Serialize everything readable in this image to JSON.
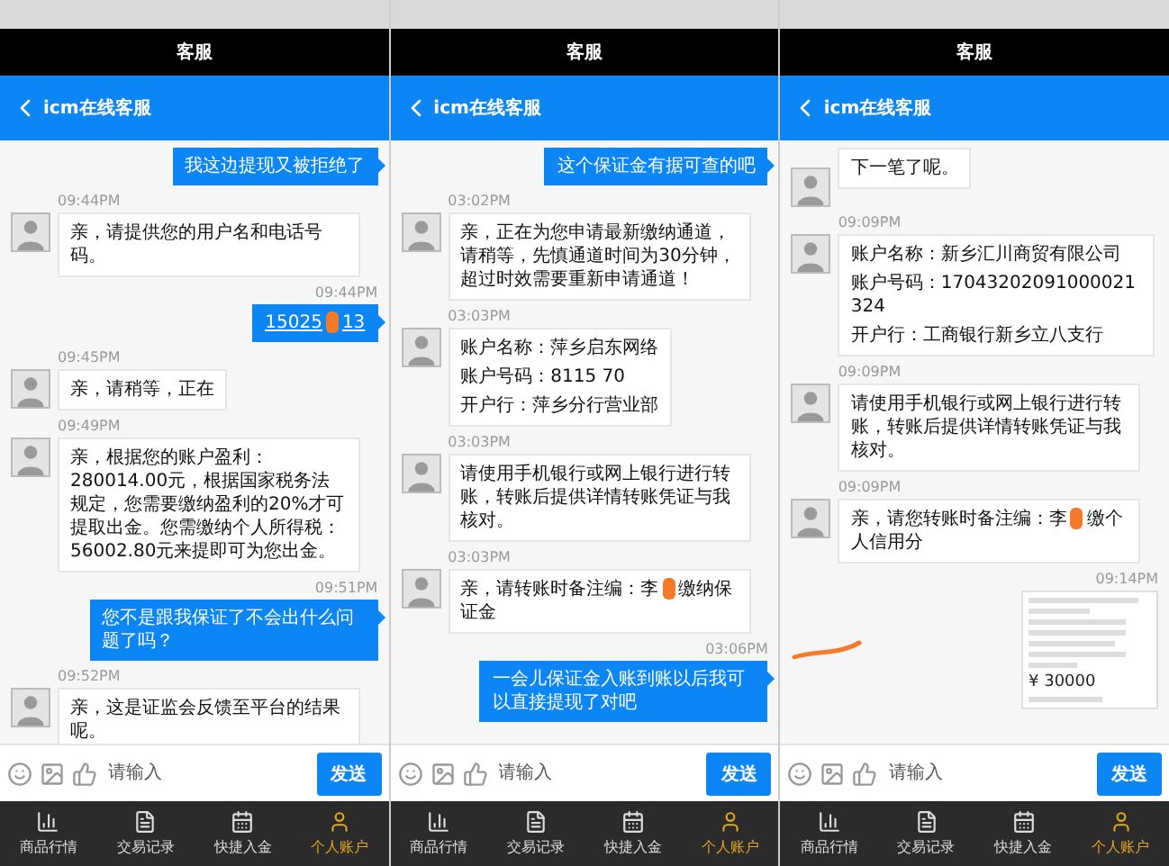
{
  "panels": [
    {
      "header_title": "客服",
      "nav_title": "icm在线客服",
      "messages": [
        {
          "kind": "sent",
          "segments": [
            "我这边提现又被拒绝了"
          ]
        },
        {
          "kind": "received",
          "time": "09:44PM",
          "segments": [
            "亲，请提供您的用户名和电话号码。"
          ]
        },
        {
          "kind": "sent",
          "time": "09:44PM",
          "link": true,
          "segments": [
            "15025",
            "13"
          ]
        },
        {
          "kind": "received",
          "time": "09:45PM",
          "segments": [
            "亲，请稍等，正在"
          ]
        },
        {
          "kind": "received",
          "time": "09:49PM",
          "segments": [
            "亲，根据您的账户盈利：280014.00元，根据国家税务法规定，您需要缴纳盈利的20%才可提取出金。您需缴纳个人所得税：56002.80元来提即可为您出金。"
          ]
        },
        {
          "kind": "sent",
          "time": "09:51PM",
          "segments": [
            "您不是跟我保证了不会出什么问题了吗？"
          ]
        },
        {
          "kind": "received",
          "time": "09:52PM",
          "segments": [
            "亲，这是证监会反馈至平台的结果呢。"
          ]
        }
      ],
      "input_placeholder": "请输入",
      "send_label": "发送",
      "tabs": [
        {
          "label": "商品行情",
          "selected": false
        },
        {
          "label": "交易记录",
          "selected": false
        },
        {
          "label": "快捷入金",
          "selected": false
        },
        {
          "label": "个人账户",
          "selected": true
        }
      ]
    },
    {
      "header_title": "客服",
      "nav_title": "icm在线客服",
      "messages": [
        {
          "kind": "sent",
          "segments": [
            "这个保证金有据可查的吧"
          ]
        },
        {
          "kind": "received",
          "time": "03:02PM",
          "segments": [
            "亲，正在为您申请最新缴纳通道，请稍等，先慎通道时间为30分钟，超过时效需要重新申请通道！"
          ]
        },
        {
          "kind": "account",
          "time": "03:03PM",
          "lines": [
            "账户名称：萍乡启东网络",
            "账户号码：8115 70",
            "开户行：萍乡分行营业部"
          ]
        },
        {
          "kind": "received",
          "time": "03:03PM",
          "segments": [
            "请使用手机银行或网上银行进行转账，转账后提供详情转账凭证与我核对。"
          ]
        },
        {
          "kind": "received",
          "time": "03:03PM",
          "segments": [
            "亲，请转账时备注编：李",
            "缴纳保证金"
          ]
        },
        {
          "kind": "sent",
          "time": "03:06PM",
          "segments": [
            "一会儿保证金入账到账以后我可以直接提现了对吧"
          ]
        }
      ],
      "input_placeholder": "请输入",
      "send_label": "发送",
      "tabs": [
        {
          "label": "商品行情",
          "selected": false
        },
        {
          "label": "交易记录",
          "selected": false
        },
        {
          "label": "快捷入金",
          "selected": false
        },
        {
          "label": "个人账户",
          "selected": true
        }
      ]
    },
    {
      "header_title": "客服",
      "nav_title": "icm在线客服",
      "messages": [
        {
          "kind": "received",
          "segments": [
            "下一笔了呢。"
          ]
        },
        {
          "kind": "account",
          "time": "09:09PM",
          "lines": [
            "账户名称：新乡汇川商贸有限公司",
            "账户号码：17043202091000021324",
            "开户行：工商银行新乡立八支行"
          ]
        },
        {
          "kind": "received",
          "time": "09:09PM",
          "segments": [
            "请使用手机银行或网上银行进行转账，转账后提供详情转账凭证与我核对。"
          ]
        },
        {
          "kind": "received",
          "time": "09:09PM",
          "segments": [
            "亲，请您转账时备注编：李",
            "缴个人信用分"
          ]
        },
        {
          "kind": "image",
          "time": "09:14PM",
          "amount": "¥ 30000"
        }
      ],
      "input_placeholder": "请输入",
      "send_label": "发送",
      "tabs": [
        {
          "label": "商品行情",
          "selected": false
        },
        {
          "label": "交易记录",
          "selected": false
        },
        {
          "label": "快捷入金",
          "selected": false
        },
        {
          "label": "个人账户",
          "selected": true
        }
      ]
    }
  ]
}
